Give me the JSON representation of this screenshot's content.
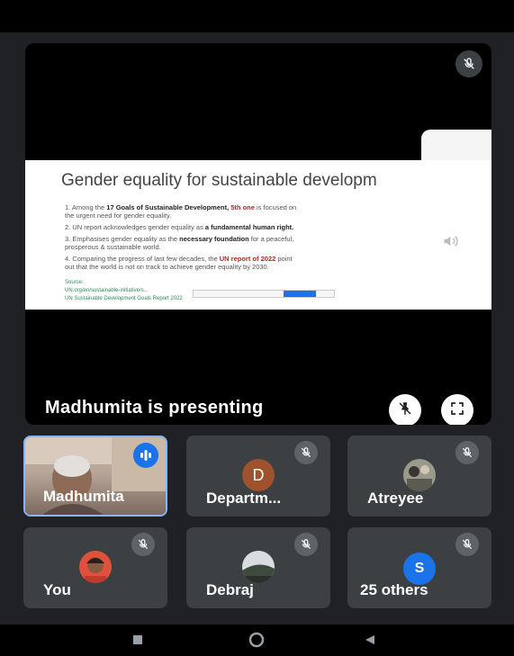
{
  "stage": {
    "presenting_text": "Madhumita is presenting",
    "slide": {
      "title": "Gender equality for sustainable developm",
      "points": [
        {
          "pre": "1.  Among the ",
          "b1": "17 Goals of Sustainable Development, ",
          "red": "5th one",
          "post": " is focused on",
          "line2": "the urgent need for gender equality."
        },
        {
          "pre": "2. UN report acknowledges gender equality as ",
          "b1": "a fundamental human right.",
          "red": "",
          "post": "",
          "line2": ""
        },
        {
          "pre": "3. Emphasises gender equality as the ",
          "b1": "necessary foundation",
          "red": "",
          "post": " for a peaceful,",
          "line2": "prosperous & sustainable world."
        },
        {
          "pre": "4. Comparing the progress of last few decades, the ",
          "b1": "",
          "red": "UN report of 2022",
          "post": " point",
          "line2": "out that the world is not on track to achieve gender equality by 2030."
        }
      ],
      "source_label": "Source:",
      "source_link": "UN.org/en/sustainable-initiative/s...",
      "source_report": "UN Sustainable Development Goals Report 2022"
    }
  },
  "tiles": [
    {
      "name": "Madhumita",
      "type": "camera"
    },
    {
      "name": "Departm...",
      "initial": "D"
    },
    {
      "name": "Atreyee",
      "type": "photo"
    },
    {
      "name": "You",
      "type": "photo"
    },
    {
      "name": "Debraj",
      "type": "photo"
    },
    {
      "name": "25 others",
      "initial": "S"
    }
  ],
  "colors": {
    "accent": "#1a73e8",
    "tile_bg": "#3c4043",
    "background": "#202124"
  },
  "icons": [
    "mic-off-icon",
    "speaker-icon",
    "pin-off-icon",
    "fullscreen-icon",
    "speaking-icon",
    "nav-recents-icon",
    "nav-home-icon",
    "nav-back-icon"
  ]
}
